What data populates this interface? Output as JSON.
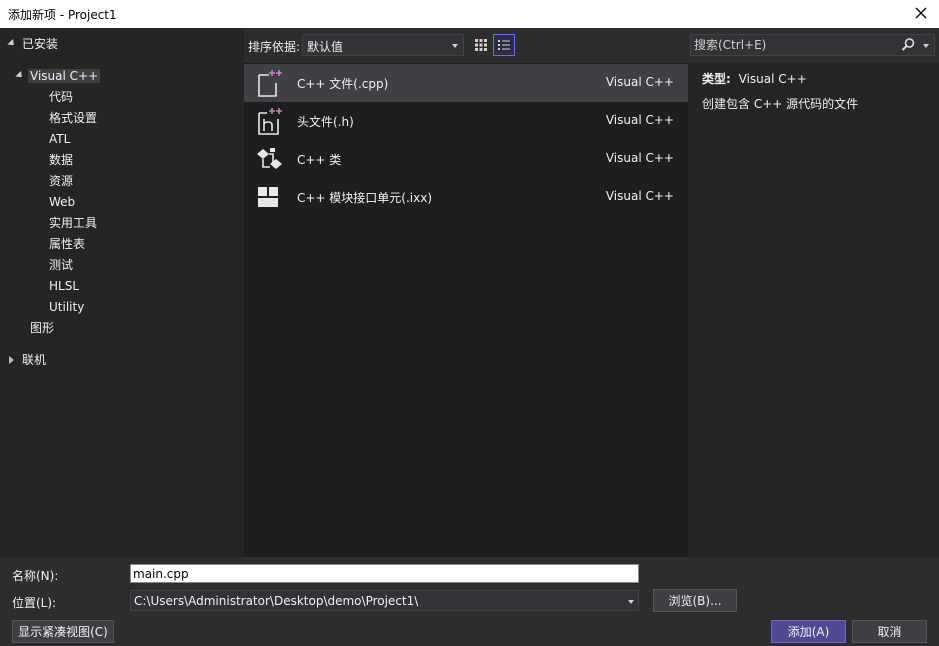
{
  "window": {
    "title": "添加新项 - Project1"
  },
  "tree": {
    "installed": "已安装",
    "visual_cpp": "Visual C++",
    "children": [
      "代码",
      "格式设置",
      "ATL",
      "数据",
      "资源",
      "Web",
      "实用工具",
      "属性表",
      "测试",
      "HLSL",
      "Utility"
    ],
    "graphics": "图形",
    "online": "联机"
  },
  "toolbar": {
    "sort_label": "排序依据:",
    "sort_value": "默认值",
    "search_placeholder": "搜索(Ctrl+E)"
  },
  "templates": [
    {
      "name": "C++ 文件(.cpp)",
      "lang": "Visual C++",
      "icon": "cpp-file-icon"
    },
    {
      "name": "头文件(.h)",
      "lang": "Visual C++",
      "icon": "header-file-icon"
    },
    {
      "name": "C++ 类",
      "lang": "Visual C++",
      "icon": "cpp-class-icon"
    },
    {
      "name": "C++ 模块接口单元(.ixx)",
      "lang": "Visual C++",
      "icon": "module-interface-icon"
    }
  ],
  "details": {
    "type_label": "类型:",
    "type_value": "Visual C++",
    "description": "创建包含 C++ 源代码的文件"
  },
  "form": {
    "name_label": "名称(N):",
    "name_value": "main.cpp",
    "location_label": "位置(L):",
    "location_value": "C:\\Users\\Administrator\\Desktop\\demo\\Project1\\",
    "browse_button": "浏览(B)..."
  },
  "footer": {
    "compact_view_button": "显示紧凑视图(C)",
    "add_button": "添加(A)",
    "cancel_button": "取消"
  },
  "colors": {
    "accent": "#6e66c4",
    "plus_badge": "#c586c0",
    "background": "#2d2d30",
    "list_bg": "#1e1e1e"
  }
}
